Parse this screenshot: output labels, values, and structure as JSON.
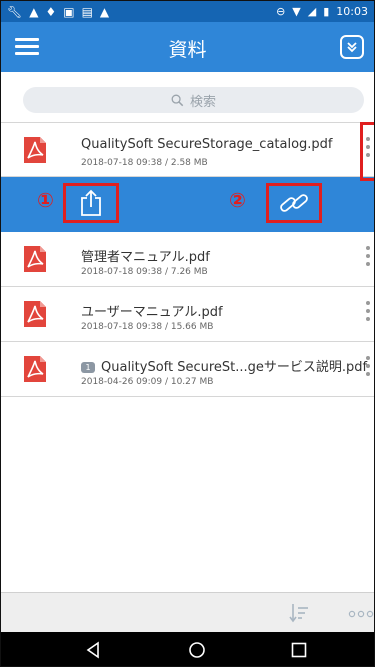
{
  "status_bar": {
    "time": "10:03",
    "left_icons": [
      "wrench-icon",
      "warning-icon",
      "shield-icon",
      "image-icon",
      "clipboard-icon",
      "warning-icon"
    ],
    "right_icons": [
      "dnd-icon",
      "wifi-icon",
      "signal-icon",
      "battery-icon"
    ]
  },
  "app_bar": {
    "title": "資料"
  },
  "search": {
    "placeholder": "検索"
  },
  "files": [
    {
      "name": "QualitySoft SecureStorage_catalog.pdf",
      "meta": "2018-07-18 09:38 / 2.58 MB",
      "badge": ""
    },
    {
      "name": "管理者マニュアル.pdf",
      "meta": "2018-07-18 09:38 / 7.26 MB",
      "badge": ""
    },
    {
      "name": "ユーザーマニュアル.pdf",
      "meta": "2018-07-18 09:38 / 15.66 MB",
      "badge": ""
    },
    {
      "name": "QualitySoft SecureSt...geサービス説明.pdf",
      "meta": "2018-04-26 09:09 / 10.27 MB",
      "badge": "1"
    }
  ],
  "action_bar": {
    "share_number": "①",
    "link_number": "②"
  },
  "colors": {
    "status_bar": "#1565b3",
    "app_bar": "#2f86d8",
    "highlight": "#e01f1f",
    "pdf_red": "#e2453c"
  }
}
